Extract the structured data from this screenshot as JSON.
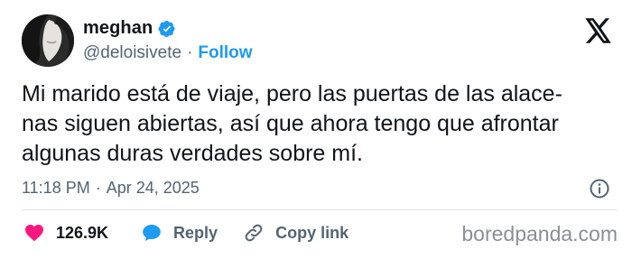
{
  "user": {
    "name": "meghan",
    "handle": "@deloisivete",
    "separator": "·",
    "follow_label": "Follow"
  },
  "tweet": {
    "text": "Mi marido está de viaje, pero las puertas de las alace-\nnas siguen abiertas, así que ahora tengo que afrontar\nalgunas duras verdades sobre mí.",
    "time": "11:18 PM",
    "meta_separator": "·",
    "date": "Apr 24, 2025"
  },
  "actions": {
    "likes": "126.9K",
    "reply_label": "Reply",
    "copy_link_label": "Copy link"
  },
  "watermark": "boredpanda.com",
  "colors": {
    "accent": "#1d9bf0",
    "like": "#f91880",
    "text": "#0f1419",
    "muted": "#536471"
  },
  "icons": {
    "verified": "verified-badge-icon",
    "x_logo": "x-logo-icon",
    "info": "info-icon",
    "like": "heart-icon",
    "reply": "speech-bubble-icon",
    "copy_link": "link-icon"
  }
}
